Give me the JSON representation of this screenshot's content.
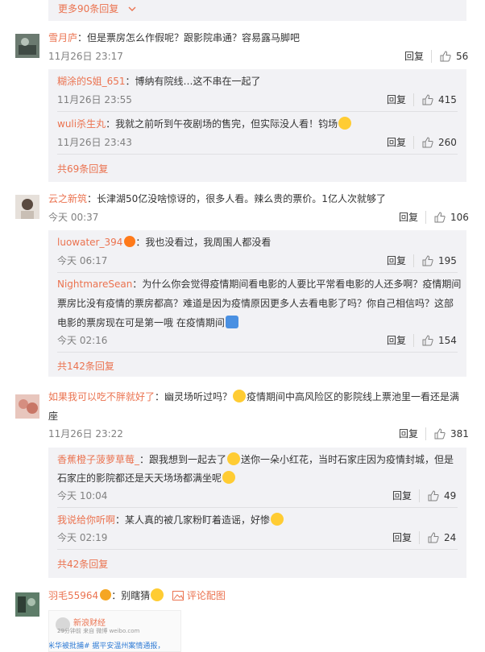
{
  "top_more": {
    "label": "更多90条回复"
  },
  "c1": {
    "user": "雪月庐",
    "sep": "：",
    "text": "但是票房怎么作假呢？跟影院串通？容易露马脚吧",
    "time": "11月26日 23:17",
    "reply": "回复",
    "likes": "56",
    "replies": [
      {
        "user": "糊涂的S姐_651",
        "sep": "：",
        "text": "博纳有院线…这不串在一起了",
        "time": "11月26日 23:55",
        "reply": "回复",
        "likes": "415"
      },
      {
        "user": "wuli杀生丸",
        "sep": "：",
        "text": "我就之前听到午夜剧场的售完，但实际没人看！钧场",
        "time": "11月26日 23:43",
        "reply": "回复",
        "likes": "260"
      }
    ],
    "more": "共69条回复"
  },
  "c2": {
    "user": "云之新筑",
    "sep": "：",
    "text": "长津湖50亿没啥惊讶的，很多人看。辣么贵的票价。1亿人次就够了",
    "time": "今天 00:37",
    "reply": "回复",
    "likes": "106",
    "replies": [
      {
        "user": "luowater_394",
        "sep": "：",
        "text": "我也没看过，我周围人都没看",
        "time": "今天 06:17",
        "reply": "回复",
        "likes": "195"
      },
      {
        "user": "NightmareSean",
        "sep": "：",
        "text_line1": "为什么你会觉得疫情期间看电影的人要比平常看电影的人还多啊？疫情期间",
        "text_line2": "票房比没有疫情的票房都高？难道是因为疫情原因更多人去看电影了吗？你自己相信吗？这部",
        "text_line3": "电影的票房现在可是第一哦 在疫情期间",
        "time": "今天 02:16",
        "reply": "回复",
        "likes": "154"
      }
    ],
    "more": "共142条回复"
  },
  "c3": {
    "user": "如果我可以吃不胖就好了",
    "sep": "：",
    "text_line1": "幽灵场听过吗？",
    "text_line1b": "疫情期间中高风险区的影院线上票池里一看还是满",
    "text_line2": "座",
    "time": "11月26日 23:22",
    "reply": "回复",
    "likes": "381",
    "replies": [
      {
        "user": "香蕉橙子菠萝草莓_",
        "sep": "：",
        "text_a": "跟我想到一起去了",
        "text_b": "送你一朵小红花，当时石家庄因为疫情封城，但是",
        "text_line2": "石家庄的影院都还是天天场场都满坐呢",
        "time": "今天 10:04",
        "reply": "回复",
        "likes": "49"
      },
      {
        "user": "我说给你听啊",
        "sep": "：",
        "text": "某人真的被几家粉盯着造谣，好惨",
        "time": "今天 02:19",
        "reply": "回复",
        "likes": "24"
      }
    ],
    "more": "共42条回复"
  },
  "c4": {
    "user": "羽毛55964",
    "sep": "：",
    "text": "别瞎猜",
    "pic_link": "评论配图",
    "preview": {
      "name": "新浪财经",
      "meta": "29分钟前  来自 微博 weibo.com",
      "snippet": "米华被批捕# 据平安温州案情通报，"
    }
  }
}
